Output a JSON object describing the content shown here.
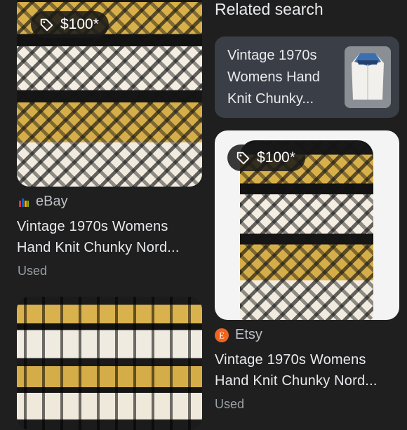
{
  "results": [
    {
      "price": "$100*",
      "source": "eBay",
      "title_lines": [
        "Vintage 1970s Womens",
        "Hand Knit Chunky Nord..."
      ],
      "condition": "Used"
    },
    {
      "price": "$100*",
      "source": "Etsy",
      "title_lines": [
        "Vintage 1970s Womens",
        "Hand Knit Chunky Nord..."
      ],
      "condition": "Used"
    }
  ],
  "related": {
    "heading": "Related search",
    "item_lines": [
      "Vintage 1970s",
      "Womens Hand",
      "Knit Chunky..."
    ]
  },
  "icons": {
    "price": "tag-icon",
    "ebay": "ebay-logo-icon",
    "etsy": "etsy-logo-icon"
  },
  "colors": {
    "background": "#1f1f1f",
    "card": "#3a3e46",
    "etsy": "#f1641e"
  }
}
